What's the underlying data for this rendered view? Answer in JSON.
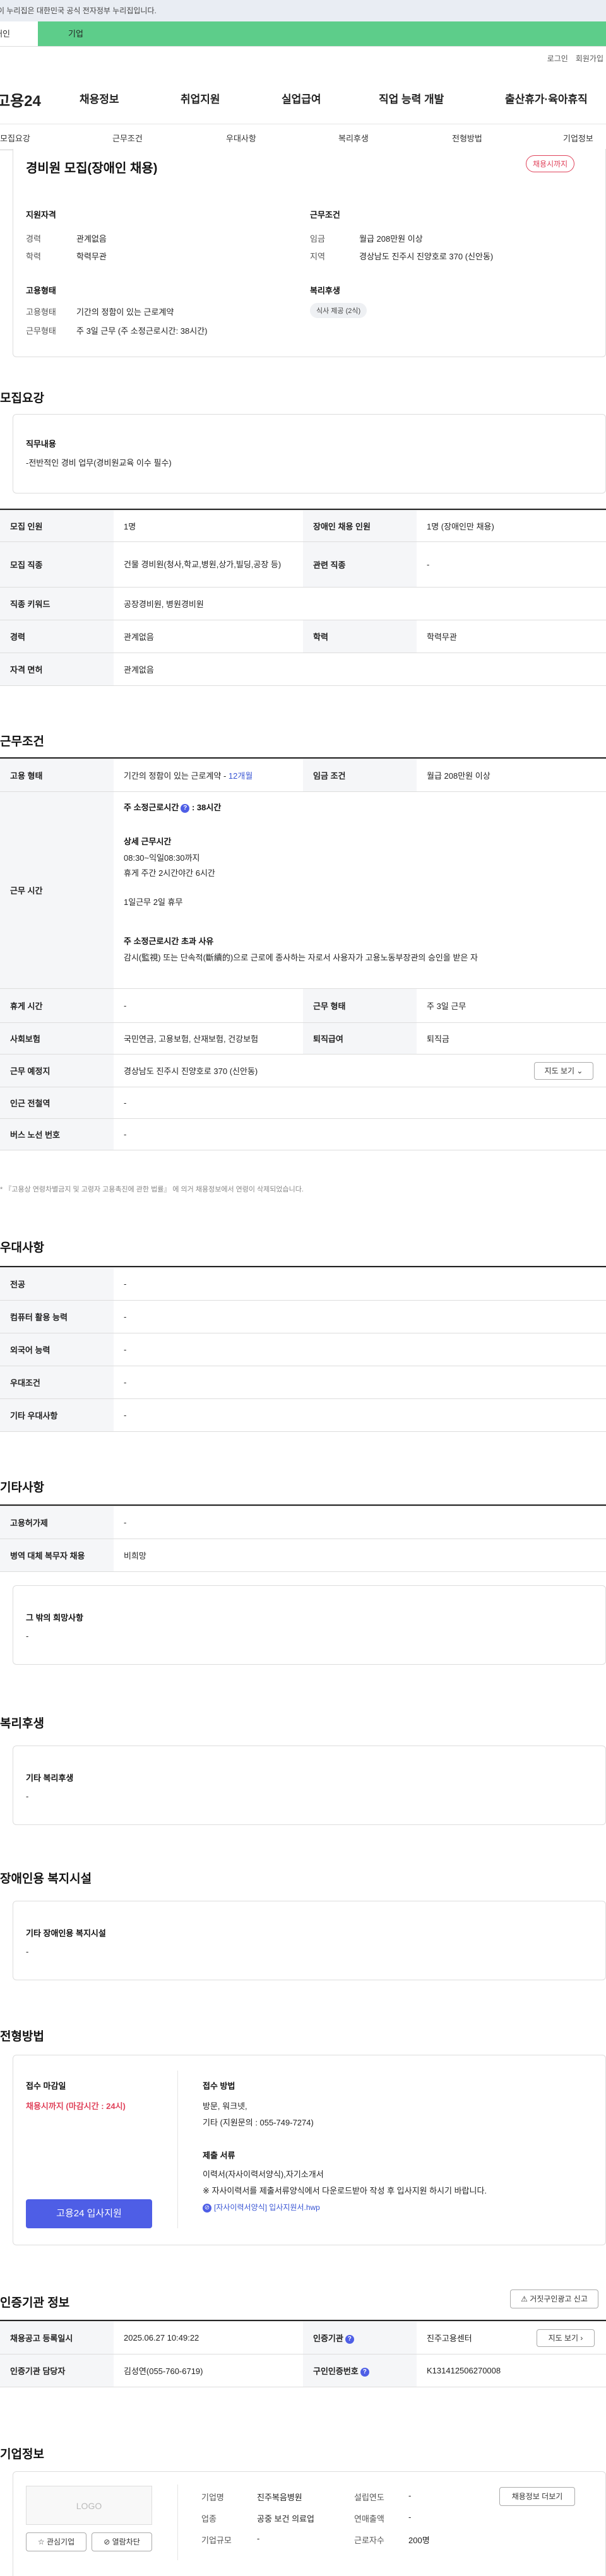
{
  "gov_banner": "이 누리집은 대한민국 공식 전자정부 누리집입니다.",
  "user_tabs": {
    "personal": "개인",
    "company": "기업"
  },
  "top_links": {
    "login": "로그인",
    "join": "회원가입"
  },
  "logo": "고용24",
  "gnb": [
    "채용정보",
    "취업지원",
    "실업급여",
    "직업 능력 개발",
    "출산휴가·육아휴직"
  ],
  "subnav": [
    "모집요강",
    "근무조건",
    "우대사항",
    "복리후생",
    "전형방법",
    "기업정보"
  ],
  "summary": {
    "title": "경비원 모집(장애인 채용)",
    "badge": "채용시까지",
    "qual_title": "지원자격",
    "career_label": "경력",
    "career": "관계없음",
    "edu_label": "학력",
    "edu": "학력무관",
    "cond_title": "근무조건",
    "wage_label": "임금",
    "wage": "월급 208만원 이상",
    "place_label": "지역",
    "place": "경상남도 진주시 진양호로 370 (신안동)",
    "emp_title": "고용형태",
    "type_label": "고용형태",
    "type": "기간의 정함이 있는 근로계약",
    "shape_label": "근무형태",
    "shape": "주 3일 근무 (주 소정근로시간: 38시간)",
    "welfare_title": "복리후생",
    "welfare_chip": "식사 제공 (2식)"
  },
  "recruit": {
    "title": "모집요강",
    "duty_label": "직무내용",
    "duty": "-전반적인 경비 업무(경비원교육 이수 필수)",
    "rows": [
      {
        "k1": "모집 인원",
        "v1": "1명",
        "k2": "장애인 채용 인원",
        "v2": "1명 (장애인만 채용)"
      },
      {
        "k1": "모집 직종",
        "v1": "건물 경비원(청사,학교,병원,상가,빌딩,공장 등)",
        "k2": "관련 직종",
        "v2": "-"
      },
      {
        "k1": "직종 키워드",
        "v1": "공장경비원, 병원경비원"
      },
      {
        "k1": "경력",
        "v1": "관계없음",
        "k2": "학력",
        "v2": "학력무관"
      },
      {
        "k1": "자격 면허",
        "v1": "관계없음"
      }
    ]
  },
  "work": {
    "title": "근무조건",
    "emp_label": "고용 형태",
    "emp_value": "기간의 정함이 있는 근로계약 - ",
    "emp_months": "12개월",
    "wage_label": "임금 조건",
    "wage_value": "월급 208만원 이상",
    "hours_label": "근무 시간",
    "hours_head": "주 소정근로시간",
    "hours_total": ": 38시간",
    "detail_head": "상세 근무시간",
    "detail1": "08:30~익일08:30까지",
    "detail2": "휴게 주간 2시간야간 6시간",
    "detail3": "1일근무 2일 휴무",
    "over_head": "주 소정근로시간 초과 사유",
    "over_text": "감시(監視) 또는 단속적(斷續的)으로 근로에 종사하는 자로서 사용자가 고용노동부장관의 승인을 받은 자",
    "rest_label": "휴게 시간",
    "rest_value": "-",
    "shape_label": "근무 형태",
    "shape_value": "주 3일 근무",
    "ins_label": "사회보험",
    "ins_value": "국민연금, 고용보험, 산재보험, 건강보험",
    "ret_label": "퇴직급여",
    "ret_value": "퇴직금",
    "loc_label": "근무 예정지",
    "loc_value": "경상남도 진주시 진양호로 370 (신안동)",
    "map_btn": "지도 보기",
    "subway_label": "인근 전철역",
    "subway_value": "-",
    "bus_label": "버스 노선 번호",
    "bus_value": "-",
    "note": "* 『고용상 연령차별금지 및 고령자 고용촉진에 관한 법률』 에 의거 채용정보에서 연령이 삭제되었습니다."
  },
  "prefer": {
    "title": "우대사항",
    "rows": [
      {
        "k": "전공",
        "v": "-"
      },
      {
        "k": "컴퓨터 활용 능력",
        "v": "-"
      },
      {
        "k": "외국어 능력",
        "v": "-"
      },
      {
        "k": "우대조건",
        "v": "-"
      },
      {
        "k": "기타 우대사항",
        "v": "-"
      }
    ]
  },
  "etc": {
    "title": "기타사항",
    "rows": [
      {
        "k": "고용허가제",
        "v": "-"
      },
      {
        "k": "병역 대체 복무자 채용",
        "v": "비희망"
      }
    ],
    "other_label": "그 밖의 희망사항",
    "other_value": "-"
  },
  "welfare": {
    "title": "복리후생",
    "label": "기타 복리후생",
    "value": "-"
  },
  "disab": {
    "title": "장애인용 복지시설",
    "label": "기타 장애인용 복지시설",
    "value": "-"
  },
  "screen": {
    "title": "전형방법",
    "deadline_label": "접수 마감일",
    "deadline_value": "채용시까지 (마감시간 : 24시)",
    "method_label": "접수 방법",
    "method1": "방문, 워크넷,",
    "method2": "기타 (지원문의 : 055-749-7274)",
    "docs_label": "제출 서류",
    "docs1": "이력서(자사이력서양식),자기소개서",
    "docs2": "※ 자사이력서를 제출서류양식에서 다운로드받아 작성 후 입사지원 하시기 바랍니다.",
    "file": "[자사이력서양식] 입사지원서.hwp",
    "apply": "고용24 입사지원"
  },
  "cert": {
    "title": "인증기관 정보",
    "report_btn": "거짓구인광고 신고",
    "reg_label": "채용공고 등록일시",
    "reg_value": "2025.06.27 10:49:22",
    "org_label": "인증기관",
    "org_value": "진주고용센터",
    "map_btn": "지도 보기",
    "mgr_label": "인증기관 담당자",
    "mgr_value": "김성연(055-760-6719)",
    "num_label": "구인인증번호",
    "num_value": "K131412506270008"
  },
  "company": {
    "title": "기업정보",
    "logo": "LOGO",
    "fav": "관심기업",
    "fav2": "열람차단",
    "detail_btn": "채용정보 더보기",
    "name_label": "기업명",
    "name_value": "진주복음병원",
    "year_label": "설립연도",
    "year_value": "-",
    "ind_label": "업종",
    "ind_value": "공중 보건 의료업",
    "sales_label": "연매출액",
    "sales_value": "-",
    "size_label": "기업규모",
    "size_value": "-",
    "emp_label": "근로자수",
    "emp_value": "200명"
  }
}
